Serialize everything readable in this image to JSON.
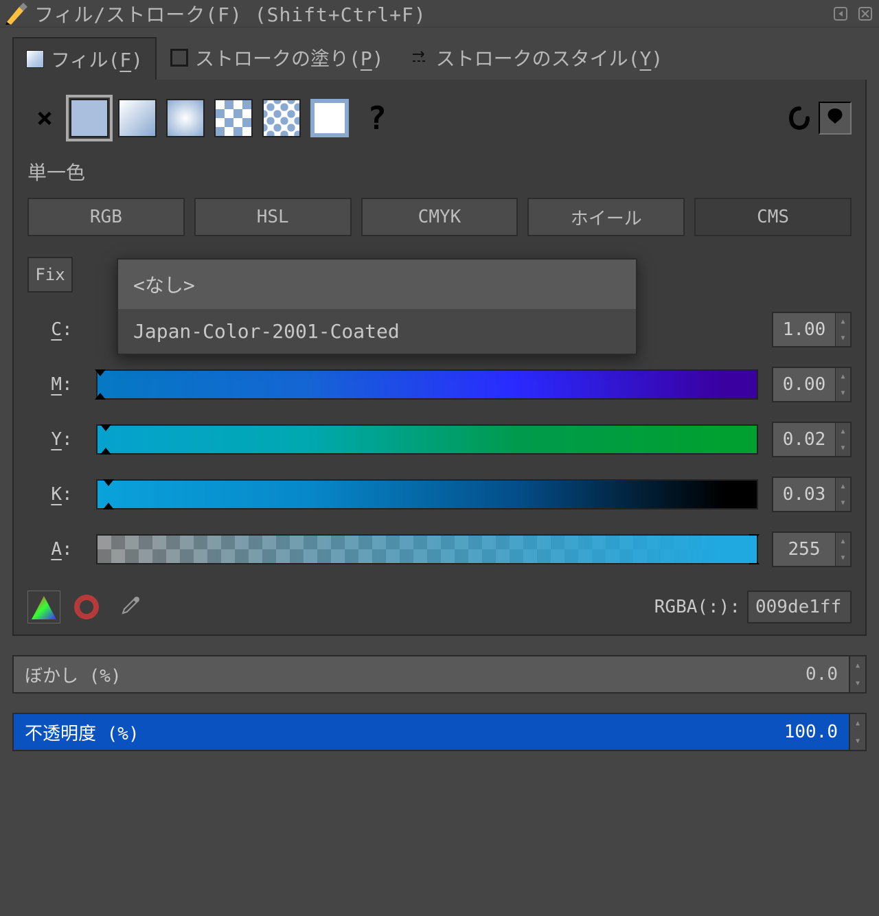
{
  "window": {
    "title": "フィル/ストローク(F) (Shift+Ctrl+F)"
  },
  "tabs": {
    "fill": {
      "label_pre": "フィル(",
      "key": "F",
      "label_post": ")"
    },
    "stroke": {
      "label_pre": "ストロークの塗り(",
      "key": "P",
      "label_post": ")"
    },
    "style": {
      "label_pre": "ストロークのスタイル(",
      "key": "Y",
      "label_post": ")"
    }
  },
  "section": {
    "flat": "単一色"
  },
  "cspace": {
    "rgb": "RGB",
    "hsl": "HSL",
    "cmyk": "CMYK",
    "wheel": "ホイール",
    "cms": "CMS"
  },
  "fix_btn": "Fix",
  "profile_dropdown": {
    "none": "<なし>",
    "selected": "Japan-Color-2001-Coated"
  },
  "channels": {
    "c": {
      "label": "C",
      "val": "1.00"
    },
    "m": {
      "label": "M",
      "val": "0.00"
    },
    "y": {
      "label": "Y",
      "val": "0.02"
    },
    "k": {
      "label": "K",
      "val": "0.03"
    },
    "a": {
      "label": "A",
      "val": "255"
    }
  },
  "rgba": {
    "label": "RGBA(:):",
    "value": "009de1ff"
  },
  "blur": {
    "label": "ぼかし (%)",
    "value": "0.0"
  },
  "opacity": {
    "label": "不透明度 (%)",
    "value": "100.0"
  }
}
